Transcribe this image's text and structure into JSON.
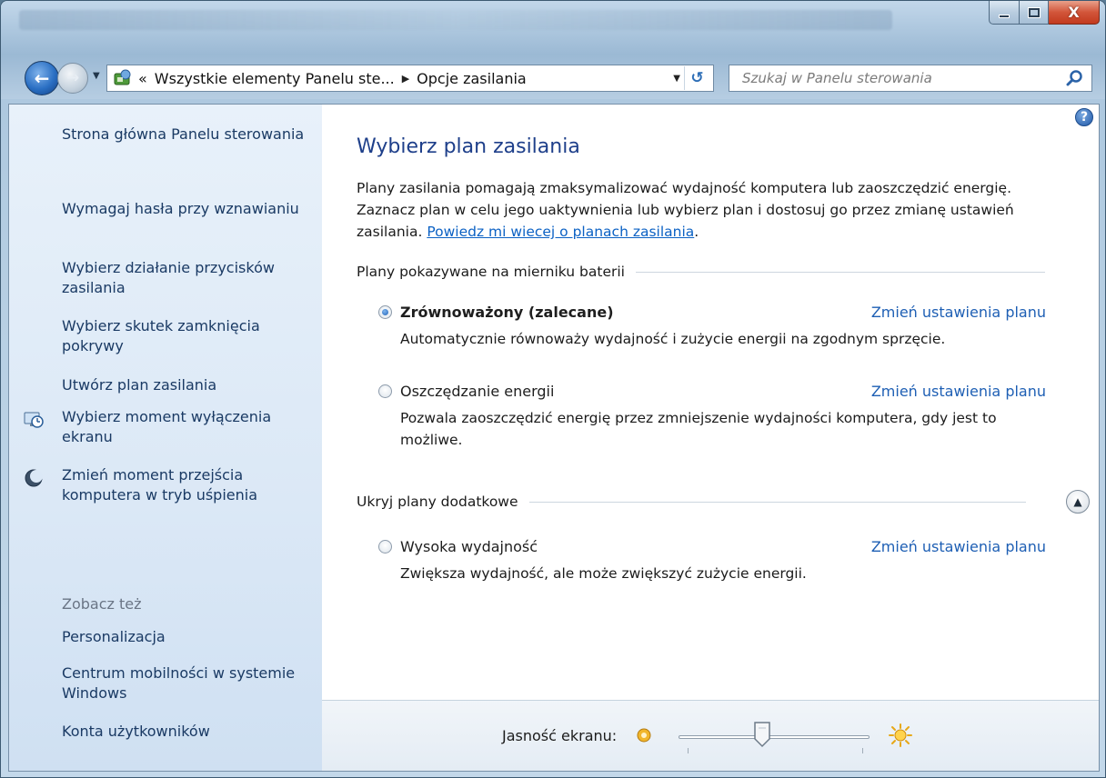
{
  "window": {
    "caption_close": "X"
  },
  "nav": {
    "address_prefix": "«",
    "address_segment_1": "Wszystkie elementy Panelu ste...",
    "address_segment_2": "Opcje zasilania",
    "search_placeholder": "Szukaj w Panelu sterowania"
  },
  "sidebar": {
    "items": [
      {
        "label": "Strona główna Panelu sterowania"
      },
      {
        "label": "Wymagaj hasła przy wznawianiu"
      },
      {
        "label": "Wybierz działanie przycisków zasilania"
      },
      {
        "label": "Wybierz skutek zamknięcia pokrywy"
      },
      {
        "label": "Utwórz plan zasilania"
      },
      {
        "label": "Wybierz moment wyłączenia ekranu",
        "icon": "clock-monitor-icon"
      },
      {
        "label": "Zmień moment przejścia komputera w tryb uśpienia",
        "icon": "moon-icon"
      }
    ],
    "see_also_title": "Zobacz też",
    "see_also": [
      {
        "label": "Personalizacja"
      },
      {
        "label": "Centrum mobilności w systemie Windows"
      },
      {
        "label": "Konta użytkowników"
      }
    ]
  },
  "main": {
    "title": "Wybierz plan zasilania",
    "intro_text": "Plany zasilania pomagają zmaksymalizować wydajność komputera lub zaoszczędzić energię. Zaznacz plan w celu jego uaktywnienia lub wybierz plan i dostosuj go przez zmianę ustawień zasilania.",
    "intro_link": "Powiedz mi wiecej o planach zasilania",
    "intro_end": ".",
    "group1_title": "Plany pokazywane na mierniku baterii",
    "group2_title": "Ukryj plany dodatkowe",
    "change_link": "Zmień ustawienia planu",
    "plans": [
      {
        "name": "Zrównoważony (zalecane)",
        "desc": "Automatycznie równoważy wydajność i zużycie energii na zgodnym sprzęcie.",
        "selected": true
      },
      {
        "name": "Oszczędzanie energii",
        "desc": "Pozwala zaoszczędzić energię przez zmniejszenie wydajności komputera, gdy jest to możliwe.",
        "selected": false
      },
      {
        "name": "Wysoka wydajność",
        "desc": "Zwiększa wydajność, ale może zwiększyć zużycie energii.",
        "selected": false
      }
    ]
  },
  "bottom": {
    "brightness_label": "Jasność ekranu:",
    "brightness_level": 0.44
  }
}
